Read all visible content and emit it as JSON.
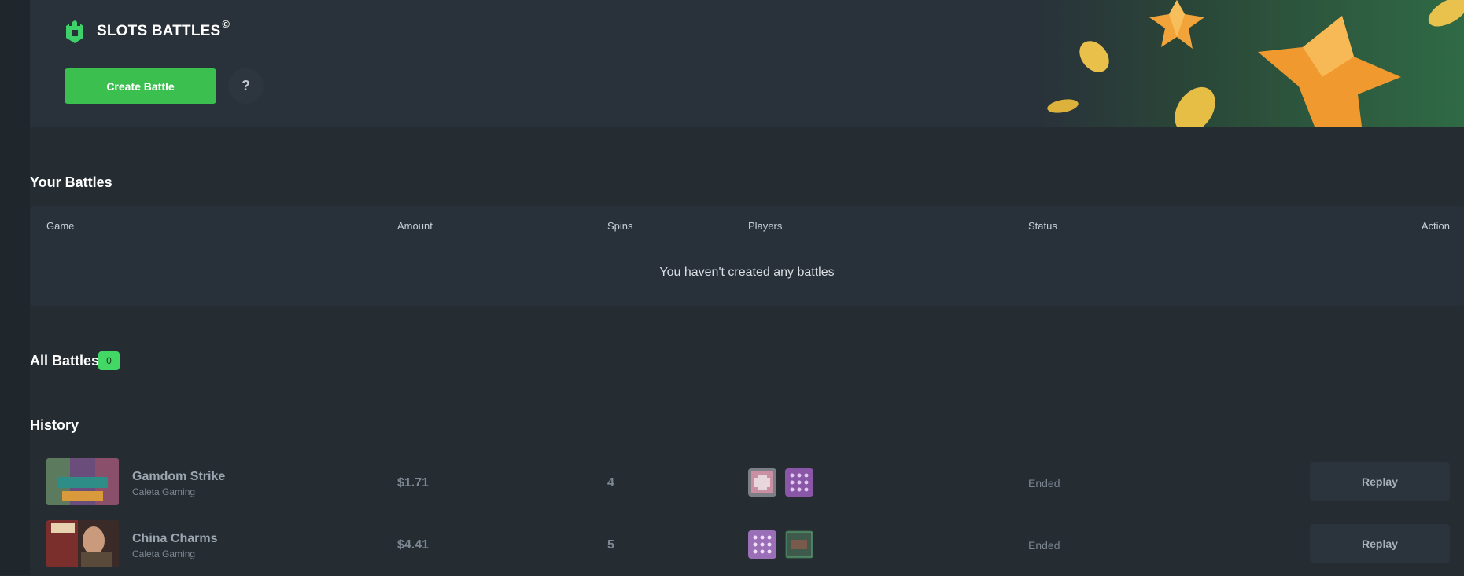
{
  "brand": {
    "title": "SLOTS BATTLES",
    "mark": "©",
    "icon": "castle-icon"
  },
  "hero": {
    "create_label": "Create Battle",
    "help_label": "?"
  },
  "your_battles": {
    "title": "Your Battles",
    "columns": [
      "Game",
      "Amount",
      "Spins",
      "Players",
      "Status",
      "Action"
    ],
    "empty_text": "You haven't created any battles"
  },
  "all_battles": {
    "title": "All Battles",
    "count": "0"
  },
  "history": {
    "title": "History",
    "rows": [
      {
        "game": "Gamdom Strike",
        "provider": "Caleta Gaming",
        "amount": "$1.71",
        "spins": "4",
        "status": "Ended",
        "action": "Replay"
      },
      {
        "game": "China Charms",
        "provider": "Caleta Gaming",
        "amount": "$4.41",
        "spins": "5",
        "status": "Ended",
        "action": "Replay"
      }
    ]
  },
  "colors": {
    "accent_green": "#3bbf4f",
    "badge_green": "#43d866",
    "background": "#252d33"
  }
}
